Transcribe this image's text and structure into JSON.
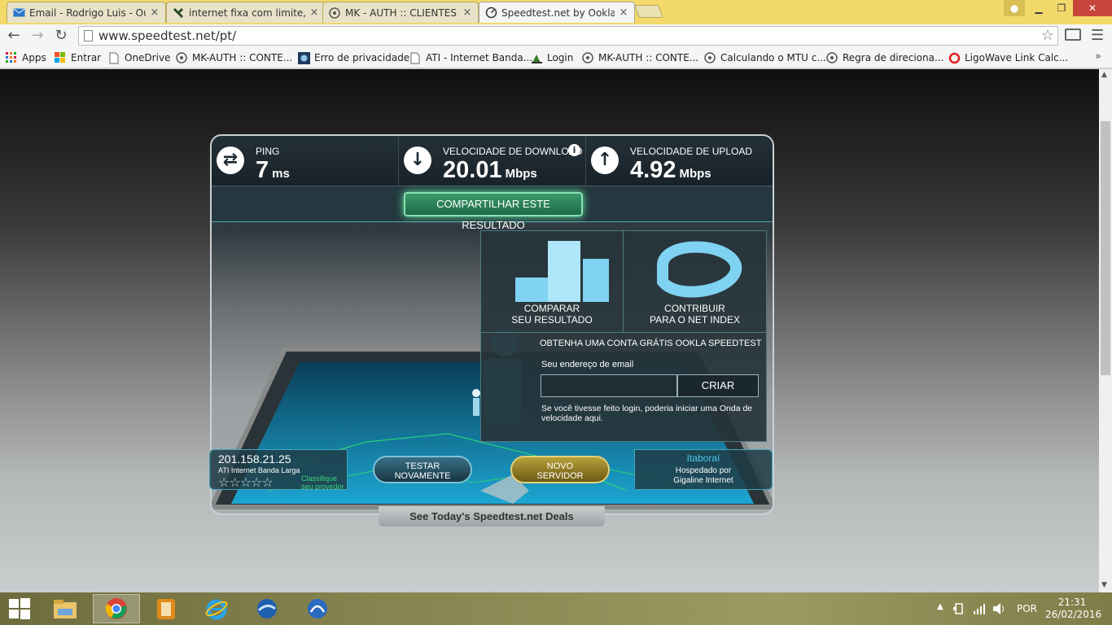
{
  "tabs": [
    {
      "title": "Email - Rodrigo Luis - Outl",
      "icon": "mail-icon",
      "active": false
    },
    {
      "title": "internet fixa com limite, ig",
      "icon": "x-icon",
      "active": false
    },
    {
      "title": "MK - AUTH :: CLIENTES",
      "icon": "mk-auth-icon",
      "active": false
    },
    {
      "title": "Speedtest.net by Ookla - T",
      "icon": "speedtest-icon",
      "active": true
    }
  ],
  "tab_close": "×",
  "window": {
    "minimize": "▁",
    "restore": "❐",
    "close": "✕"
  },
  "address": {
    "url": "www.speedtest.net/pt/"
  },
  "bookmarks": [
    {
      "label": "Apps",
      "icon": "apps-grid-icon"
    },
    {
      "label": "Entrar",
      "icon": "windows-logo-icon"
    },
    {
      "label": "OneDrive",
      "icon": "page-icon"
    },
    {
      "label": "MK-AUTH :: CONTE...",
      "icon": "mk-auth-icon"
    },
    {
      "label": "Erro de privacidade",
      "icon": "router-icon"
    },
    {
      "label": "ATI - Internet Banda...",
      "icon": "page-icon"
    },
    {
      "label": "Login",
      "icon": "login-icon"
    },
    {
      "label": "MK-AUTH :: CONTE...",
      "icon": "mk-auth-icon"
    },
    {
      "label": "Calculando o MTU c...",
      "icon": "mk-auth-icon"
    },
    {
      "label": "Regra de direciona...",
      "icon": "mk-auth-icon"
    },
    {
      "label": "LigoWave Link Calc...",
      "icon": "ligowave-icon"
    }
  ],
  "bookmarks_more": "»",
  "speedtest": {
    "ping": {
      "label": "PING",
      "value": "7",
      "unit": "ms"
    },
    "download": {
      "label": "VELOCIDADE DE DOWNLOAD",
      "value": "20.01",
      "unit": "Mbps"
    },
    "upload": {
      "label": "VELOCIDADE DE UPLOAD",
      "value": "4.92",
      "unit": "Mbps"
    },
    "share_label": "COMPARTILHAR ESTE RESULTADO",
    "compare_line1": "COMPARAR",
    "compare_line2": "SEU RESULTADO",
    "contribute_line1": "CONTRIBUIR",
    "contribute_line2": "PARA O NET INDEX",
    "signup_title": "OBTENHA UMA CONTA GRÁTIS OOKLA SPEEDTEST",
    "email_label": "Seu endereço de email",
    "email_value": "",
    "create_label": "CRIAR",
    "signup_note": "Se você tivesse feito login, poderia iniciar uma Onda de velocidade aqui.",
    "isp": {
      "ip": "201.158.21.25",
      "name": "ATI Internet Banda Larga",
      "stars": "☆☆☆☆☆",
      "rate_label": "Classifique seu provedor"
    },
    "retest_line1": "TESTAR",
    "retest_line2": "NOVAMENTE",
    "server_line1": "NOVO",
    "server_line2": "SERVIDOR",
    "host_city": "Itaboraí",
    "host_line1": "Hospedado por",
    "host_line2": "Gigaline Internet"
  },
  "deals": "See Today's Speedtest.net Deals",
  "taskbar": {
    "lang": "POR",
    "time": "21:31",
    "date": "26/02/2016"
  },
  "colors": {
    "accent": "#47c9e8",
    "share": "#3a9a6b",
    "server_button": "#b8a03a"
  }
}
